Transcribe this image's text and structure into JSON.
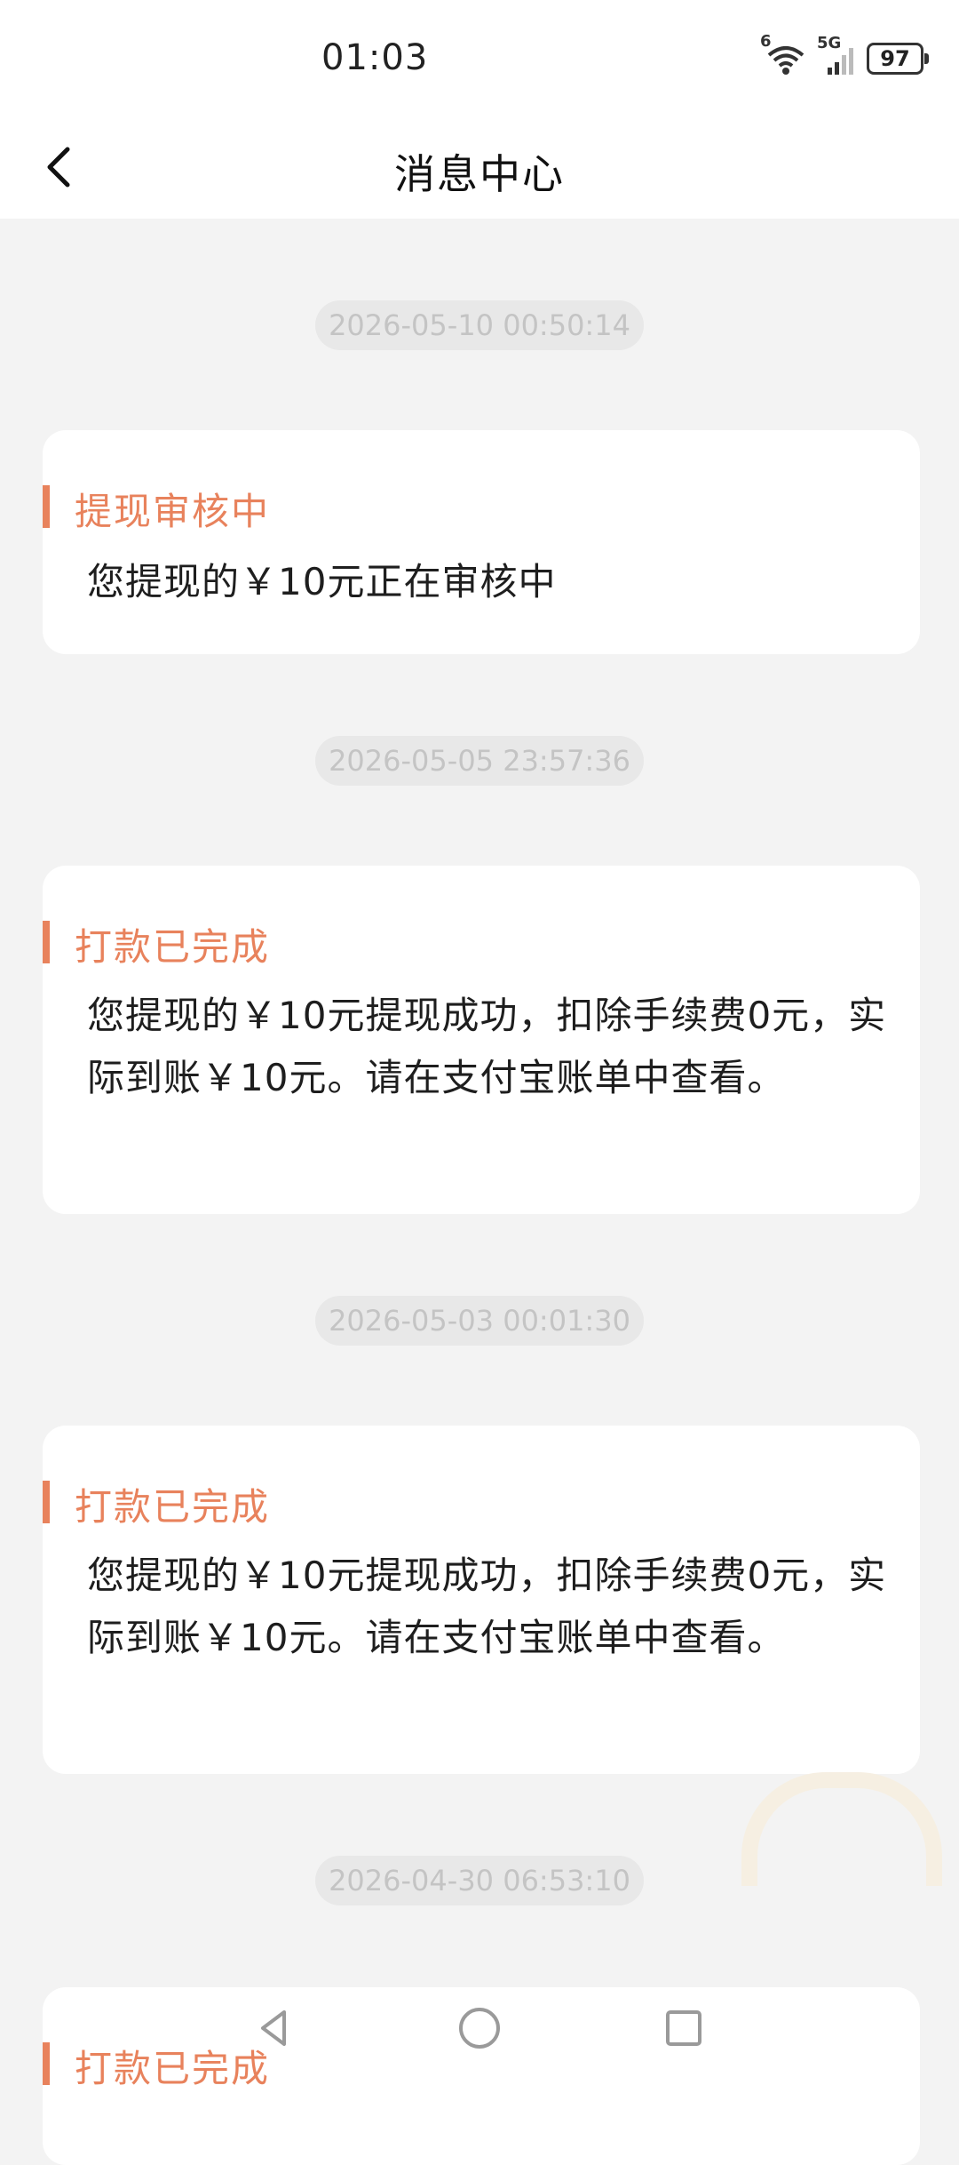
{
  "status_bar": {
    "time": "01:03",
    "battery": "97",
    "network": "5G",
    "wifi_badge": "6"
  },
  "header": {
    "title": "消息中心"
  },
  "messages": [
    {
      "time": "2026-05-10 00:50:14",
      "title": "提现审核中",
      "body": "您提现的￥10元正在审核中"
    },
    {
      "time": "2026-05-05 23:57:36",
      "title": "打款已完成",
      "body": "您提现的￥10元提现成功，扣除手续费0元，实际到账￥10元。请在支付宝账单中查看。"
    },
    {
      "time": "2026-05-03 00:01:30",
      "title": "打款已完成",
      "body": "您提现的￥10元提现成功，扣除手续费0元，实际到账￥10元。请在支付宝账单中查看。"
    },
    {
      "time": "2026-04-30 06:53:10",
      "title": "打款已完成",
      "body": ""
    }
  ],
  "colors": {
    "accent": "#e8825c",
    "background": "#f3f3f3",
    "card": "#ffffff",
    "pill": "#e8e8e8"
  }
}
